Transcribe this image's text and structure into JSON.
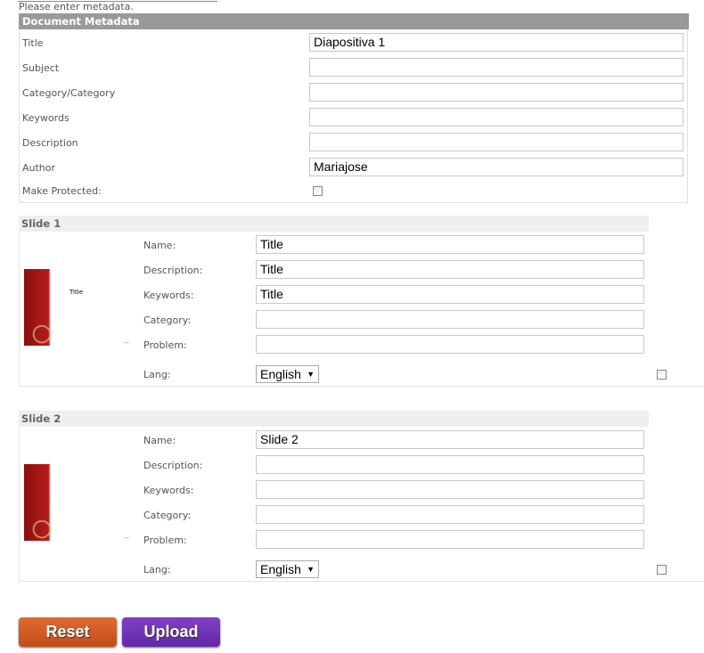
{
  "intro": "Please enter metadata.",
  "meta": {
    "header": "Document Metadata",
    "fields": [
      {
        "label": "Title",
        "value": "Diapositiva 1"
      },
      {
        "label": "Subject",
        "value": ""
      },
      {
        "label": "Category/Category",
        "value": ""
      },
      {
        "label": "Keywords",
        "value": ""
      },
      {
        "label": "Description",
        "value": ""
      },
      {
        "label": "Author",
        "value": "Mariajose"
      }
    ],
    "protected_label": "Make Protected:"
  },
  "slides": [
    {
      "header": "Slide 1",
      "thumb_text": "Title",
      "dash": "--",
      "name_label": "Name:",
      "name": "Title",
      "desc_label": "Description:",
      "desc": "Title",
      "kw_label": "Keywords:",
      "kw": "Title",
      "cat_label": "Category:",
      "cat": "",
      "prob_label": "Problem:",
      "prob": "",
      "lang_label": "Lang:",
      "lang": "English"
    },
    {
      "header": "Slide 2",
      "thumb_text": "",
      "dash": "--",
      "name_label": "Name:",
      "name": "Slide 2",
      "desc_label": "Description:",
      "desc": "",
      "kw_label": "Keywords:",
      "kw": "",
      "cat_label": "Category:",
      "cat": "",
      "prob_label": "Problem:",
      "prob": "",
      "lang_label": "Lang:",
      "lang": "English"
    }
  ],
  "buttons": {
    "reset": "Reset",
    "upload": "Upload"
  },
  "colors": {
    "reset": "#cf5a22",
    "upload": "#7033b5",
    "header": "#999999"
  }
}
